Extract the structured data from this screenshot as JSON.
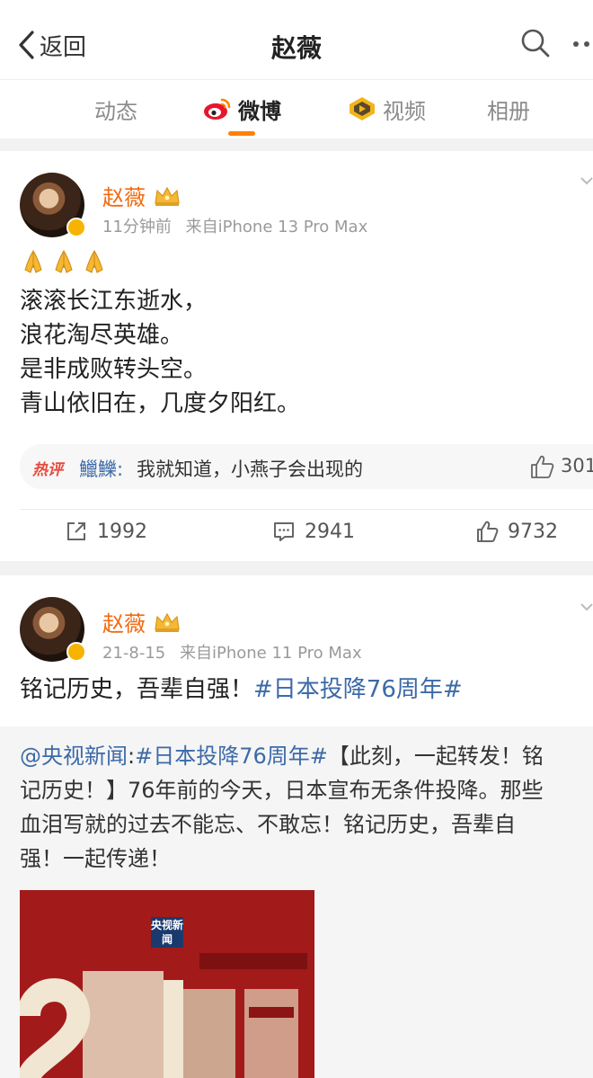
{
  "header": {
    "back_label": "返回",
    "title": "赵薇"
  },
  "tabs": [
    {
      "label": "动态",
      "active": false
    },
    {
      "label": "微博",
      "active": true
    },
    {
      "label": "视频",
      "active": false
    },
    {
      "label": "相册",
      "active": false
    }
  ],
  "colors": {
    "accent": "#ff8200",
    "username": "#f26a10",
    "link": "#3c6aa8",
    "hot_badge": "#e84a3c"
  },
  "posts": [
    {
      "username": "赵薇",
      "time": "11分钟前",
      "source": "来自iPhone 13 Pro Max",
      "emojis": [
        "pray-icon",
        "pray-icon",
        "pray-icon"
      ],
      "lines": [
        "滚滚长江东逝水，",
        "浪花淘尽英雄。",
        "是非成败转头空。",
        "青山依旧在，几度夕阳红。"
      ],
      "hot_comment": {
        "badge": "热评",
        "user": "鱲鱳:",
        "text": "我就知道，小燕子会出现的",
        "likes": "301"
      },
      "actions": {
        "reposts": "1992",
        "comments": "2941",
        "likes": "9732"
      }
    },
    {
      "username": "赵薇",
      "time": "21-8-15",
      "source": "来自iPhone 11 Pro Max",
      "text": "铭记历史，吾辈自强！",
      "hashtag": "#日本投降76周年#",
      "quote": {
        "author": "@央视新闻",
        "sep": ":",
        "hashtag": "#日本投降76周年#",
        "line1_rest": "【此刻，一起转发！铭",
        "line2": "记历史！】76年前的今天，日本宣布无条件投降。那些",
        "line3": "血泪写就的过去不能忘、不敢忘！铭记历史，吾辈自",
        "line4": "强！一起传递！",
        "image_badge": "央视新闻"
      }
    }
  ]
}
